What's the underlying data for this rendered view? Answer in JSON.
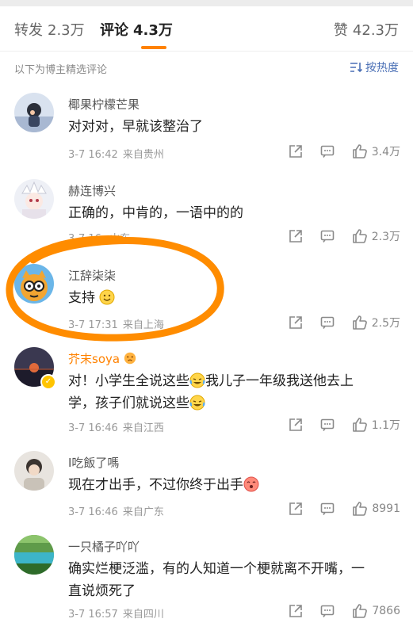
{
  "tabs": [
    {
      "label": "转发",
      "count": "2.3万"
    },
    {
      "label": "评论",
      "count": "4.3万"
    },
    {
      "label": "赞",
      "count": "42.3万"
    }
  ],
  "note": "以下为博主精选评论",
  "sort_label": "按热度",
  "comments": [
    {
      "name": "椰果柠檬芒果",
      "text": "对对对，早就该整治了",
      "time": "3-7 16:42",
      "location": "来自贵州",
      "likes": "3.4万"
    },
    {
      "name": "赫连博兴",
      "text": "正确的，中肯的，一语中的的",
      "time": "3-7 16:",
      "location": "山东",
      "likes": "2.3万"
    },
    {
      "name": "江辞柒柒",
      "text": "支持",
      "time": "3-7 17:31",
      "location": "来自上海",
      "likes": "2.5万"
    },
    {
      "name": "芥末soya",
      "text_1": "对！小学生全说这些",
      "text_2": "我儿子一年级我送他去上",
      "text_3": "学，孩子们就说这些",
      "time": "3-7 16:46",
      "location": "来自江西",
      "likes": "1.1万"
    },
    {
      "name": "I吃飯了嗎",
      "text": "现在才出手，不过你终于出手",
      "time": "3-7 16:46",
      "location": "来自广东",
      "likes": "8991"
    },
    {
      "name": "一只橘子吖吖",
      "text_1": "确实烂梗泛滥，有的人知道一个梗就离不开嘴，一",
      "text_2": "直说烦死了",
      "time": "3-7 16:57",
      "location": "来自四川",
      "likes": "7866"
    }
  ],
  "colors": {
    "accent": "#ff8200",
    "link": "#4a6fb5",
    "annotation": "#ff8c00"
  }
}
